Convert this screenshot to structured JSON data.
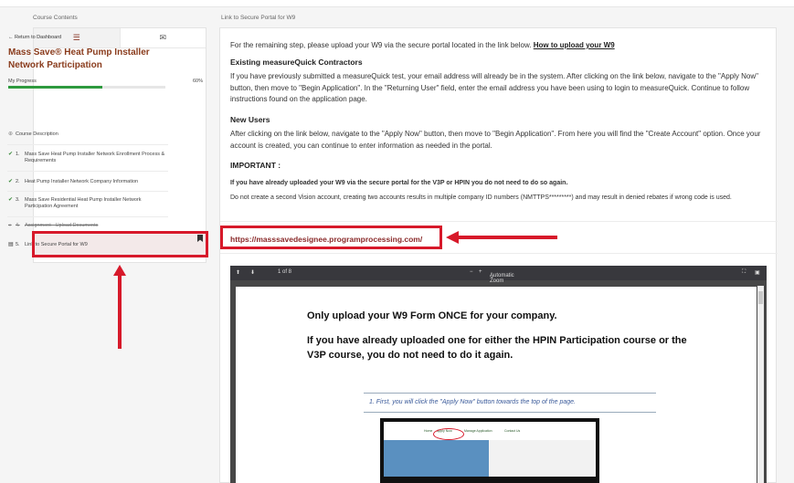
{
  "labels": {
    "course_contents": "Course Contents",
    "main_section": "Link to Secure Portal for W9"
  },
  "sidebar": {
    "back": "Return to Dashboard",
    "course_title": "Mass Save® Heat Pump Installer Network Participation",
    "progress_label": "My Progress",
    "progress_pct": "60%",
    "progress_value": 0.6,
    "description": "Course Description",
    "items": [
      {
        "num": "1.",
        "label": "Mass Save Heat Pump Installer Network Enrollment Process & Requirements"
      },
      {
        "num": "2.",
        "label": "Heat Pump Installer Network Company Information"
      },
      {
        "num": "3.",
        "label": "Mass Save Residential Heat Pump Installer Network Participation Agreement"
      },
      {
        "num": "4.",
        "label": "Assignment - Upload Documents"
      },
      {
        "num": "5.",
        "label": "Link to Secure Portal for W9"
      }
    ]
  },
  "content": {
    "intro": "For the remaining step, please upload your W9 via the secure portal located in the link below.",
    "intro_link": "How to upload your W9",
    "existing_heading": "Existing measureQuick Contractors",
    "existing_text": "If you have previously submitted a measureQuick test, your email address will already be in the system. After clicking on the link below, navigate to the \"Apply Now\" button, then move to \"Begin Application\". In the \"Returning User\" field, enter the email address you have been using to login to measureQuick. Continue to follow instructions found on the application page.",
    "new_heading": "New Users",
    "new_text": "After clicking on the link below, navigate to the \"Apply Now\" button, then move to \"Begin Application\". From here you will find the \"Create Account\" option. Once your account is created, you can continue to enter information as needed in the portal.",
    "important_heading": "IMPORTANT :",
    "important_bold": "If you have already uploaded your W9 via the secure portal for the V3P or HPIN you do not need to do so again.",
    "important_text": "Do not create a second Vision account, creating two accounts results in multiple company ID numbers (NMTTPS*********) and may result in denied rebates if wrong code is used.",
    "portal_link": "https://masssavedesignee.programprocessing.com/"
  },
  "pdf": {
    "page_indicator": "1 of 8",
    "zoom": "Automatic Zoom",
    "heading1": "Only upload your W9 Form ONCE for your company.",
    "heading2": "If you have already uploaded one for either the HPIN Participation course or the V3P course, you do not need to do it again.",
    "step1": "1.   First, you will click the \"Apply Now\" button towards the top of the page.",
    "shot_nav": [
      "Home",
      "Apply Now",
      "Manage Application",
      "Contact Us"
    ]
  },
  "colors": {
    "accent": "#8a3c1d",
    "highlight": "#d7192a",
    "progress": "#2e9a3e"
  }
}
